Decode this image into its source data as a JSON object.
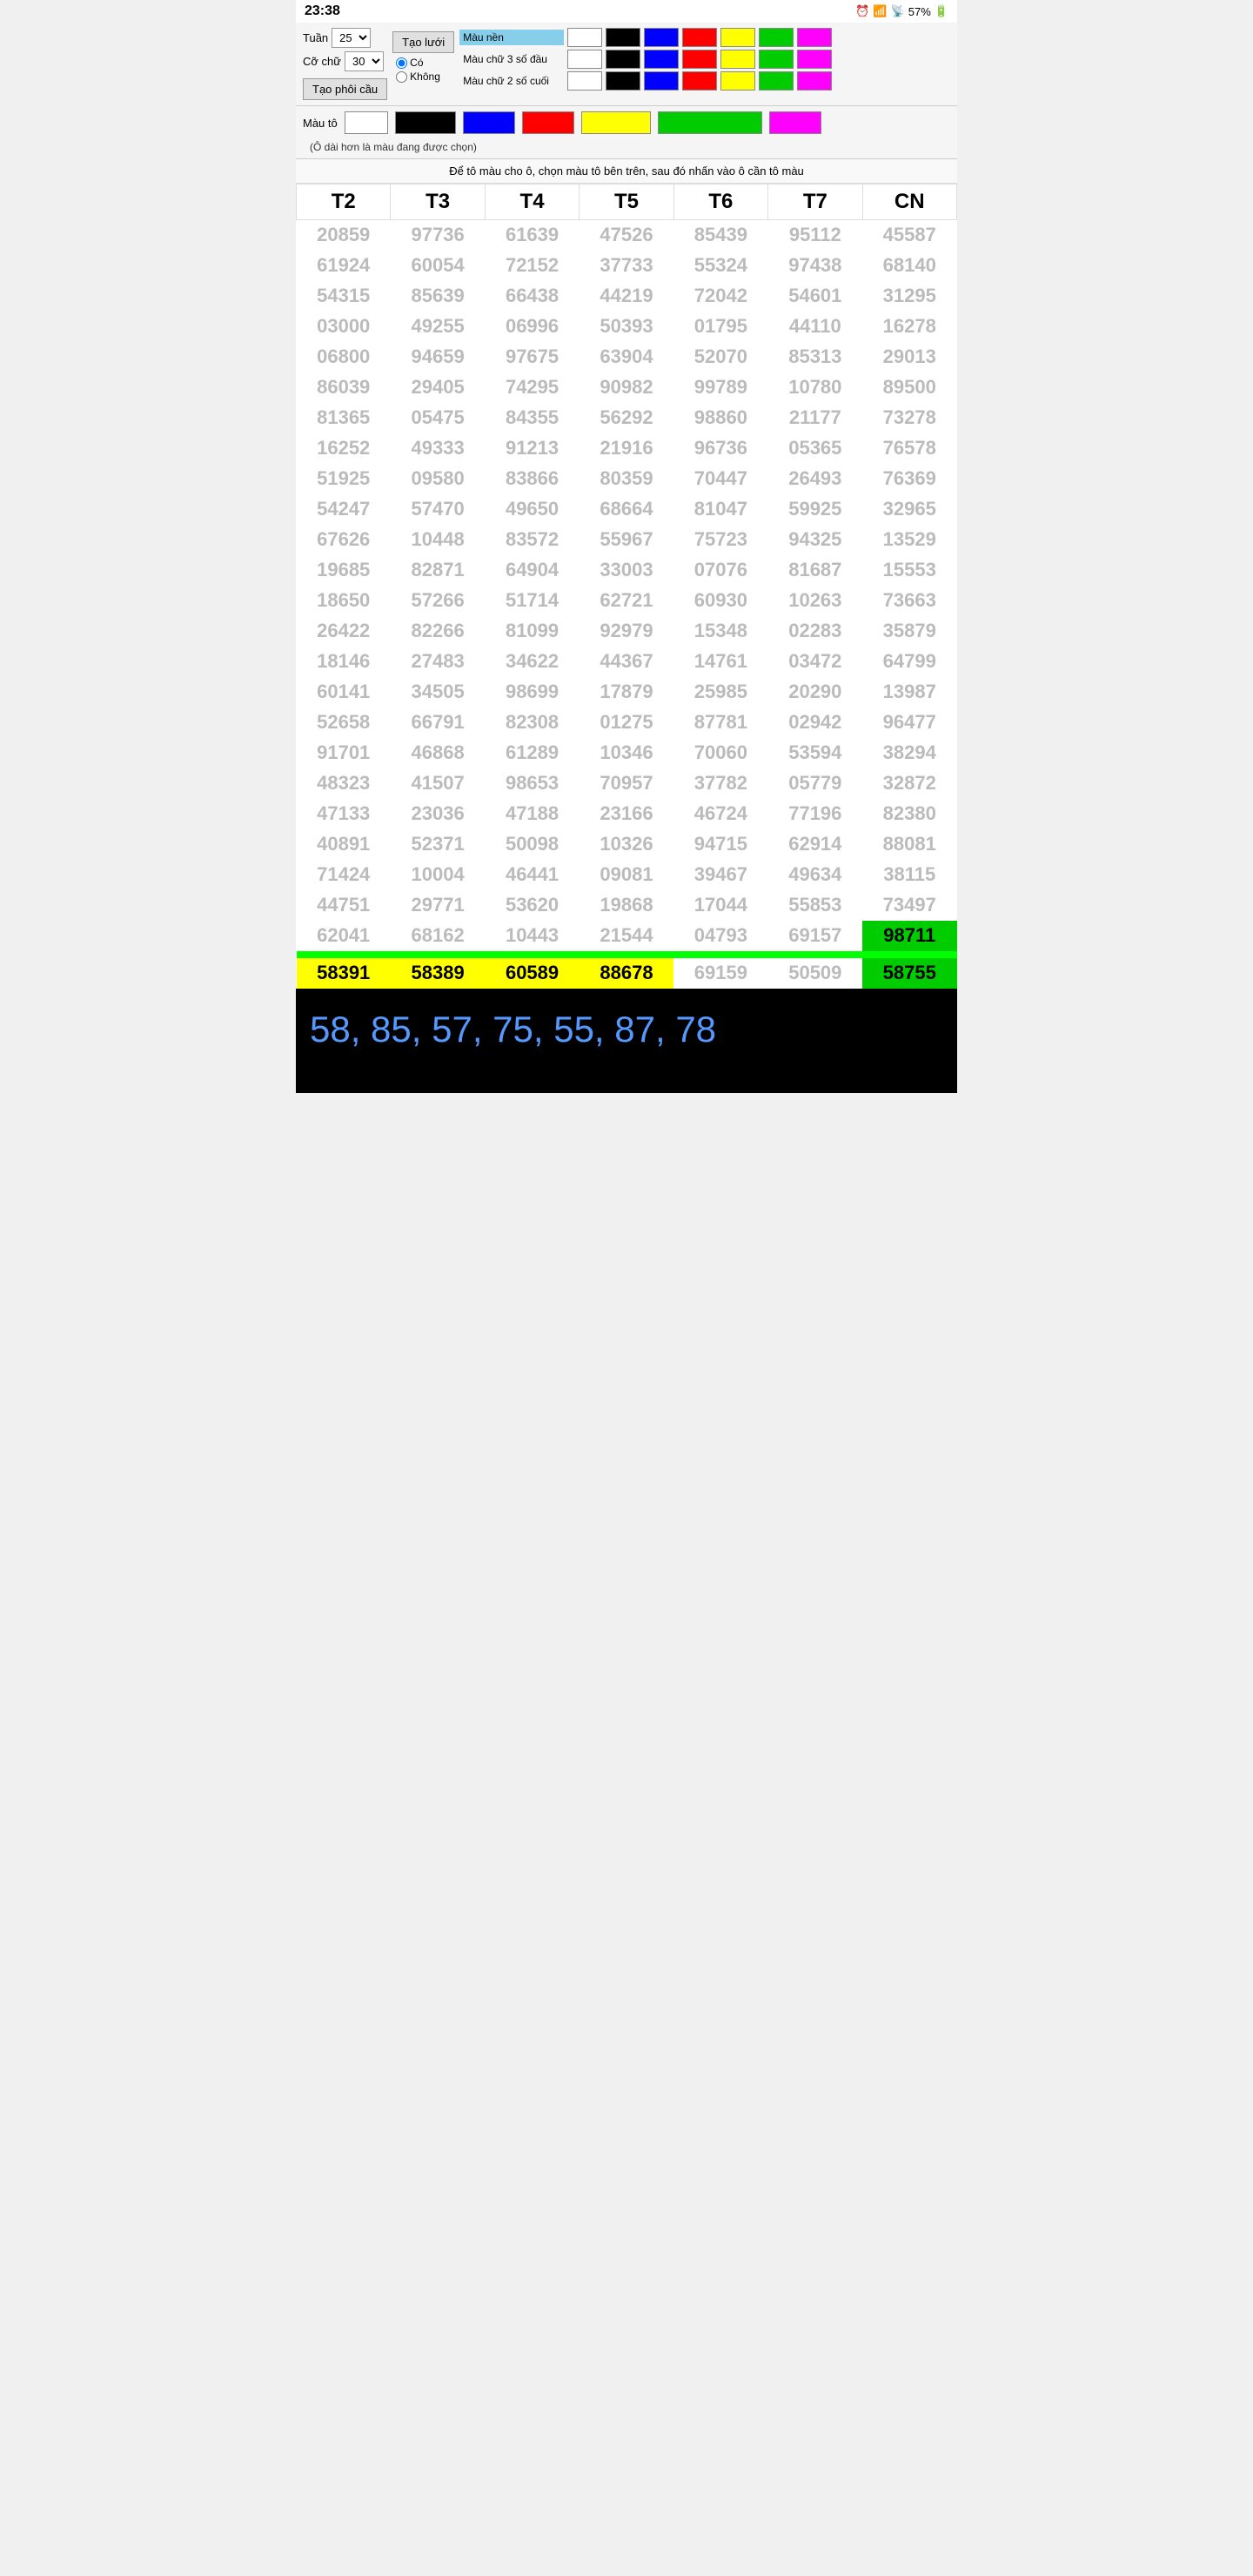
{
  "statusBar": {
    "time": "23:38",
    "battery": "57%",
    "signal": "4G"
  },
  "controls": {
    "tuan_label": "Tuần",
    "tuan_value": "25",
    "cochuu_label": "Cỡ chữ",
    "cochuu_value": "30",
    "btn_tao_luoi": "Tạo lưới",
    "btn_tao_phoi_cau": "Tạo phôi cầu",
    "radio_co": "Có",
    "radio_khong": "Không"
  },
  "colorSection": {
    "mau_nen_label": "Màu nền",
    "mau_chu_3_label": "Màu chữ 3 số đầu",
    "mau_chu_2_label": "Màu chữ 2 số cuối",
    "colors": [
      "white",
      "black",
      "blue",
      "red",
      "yellow",
      "green",
      "magenta"
    ]
  },
  "mauTo": {
    "label": "Màu tô",
    "note": "(Ô dài hơn là màu đang được chọn)"
  },
  "instruction": "Để tô màu cho ô, chọn màu tô bên trên, sau đó nhấn vào ô cần tô màu",
  "tableHeaders": [
    "T2",
    "T3",
    "T4",
    "T5",
    "T6",
    "T7",
    "CN"
  ],
  "tableRows": [
    [
      "20859",
      "97736",
      "61639",
      "47526",
      "85439",
      "95112",
      "45587"
    ],
    [
      "61924",
      "60054",
      "72152",
      "37733",
      "55324",
      "97438",
      "68140"
    ],
    [
      "54315",
      "85639",
      "66438",
      "44219",
      "72042",
      "54601",
      "31295"
    ],
    [
      "03000",
      "49255",
      "06996",
      "50393",
      "01795",
      "44110",
      "16278"
    ],
    [
      "06800",
      "94659",
      "97675",
      "63904",
      "52070",
      "85313",
      "29013"
    ],
    [
      "86039",
      "29405",
      "74295",
      "90982",
      "99789",
      "10780",
      "89500"
    ],
    [
      "81365",
      "05475",
      "84355",
      "56292",
      "98860",
      "21177",
      "73278"
    ],
    [
      "16252",
      "49333",
      "91213",
      "21916",
      "96736",
      "05365",
      "76578"
    ],
    [
      "51925",
      "09580",
      "83866",
      "80359",
      "70447",
      "26493",
      "76369"
    ],
    [
      "54247",
      "57470",
      "49650",
      "68664",
      "81047",
      "59925",
      "32965"
    ],
    [
      "67626",
      "10448",
      "83572",
      "55967",
      "75723",
      "94325",
      "13529"
    ],
    [
      "19685",
      "82871",
      "64904",
      "33003",
      "07076",
      "81687",
      "15553"
    ],
    [
      "18650",
      "57266",
      "51714",
      "62721",
      "60930",
      "10263",
      "73663"
    ],
    [
      "26422",
      "82266",
      "81099",
      "92979",
      "15348",
      "02283",
      "35879"
    ],
    [
      "18146",
      "27483",
      "34622",
      "44367",
      "14761",
      "03472",
      "64799"
    ],
    [
      "60141",
      "34505",
      "98699",
      "17879",
      "25985",
      "20290",
      "13987"
    ],
    [
      "52658",
      "66791",
      "82308",
      "01275",
      "87781",
      "02942",
      "96477"
    ],
    [
      "91701",
      "46868",
      "61289",
      "10346",
      "70060",
      "53594",
      "38294"
    ],
    [
      "48323",
      "41507",
      "98653",
      "70957",
      "37782",
      "05779",
      "32872"
    ],
    [
      "47133",
      "23036",
      "47188",
      "23166",
      "46724",
      "77196",
      "82380"
    ],
    [
      "40891",
      "52371",
      "50098",
      "10326",
      "94715",
      "62914",
      "88081"
    ],
    [
      "71424",
      "10004",
      "46441",
      "09081",
      "39467",
      "49634",
      "38115"
    ],
    [
      "44751",
      "29771",
      "53620",
      "19868",
      "17044",
      "55853",
      "73497"
    ],
    [
      "62041",
      "68162",
      "10443",
      "21544",
      "04793",
      "69157",
      "98711"
    ],
    [
      "58391",
      "58389",
      "60589",
      "88678",
      "69159",
      "50509",
      "58755"
    ]
  ],
  "highlightLastRow": {
    "rowIndex": 24,
    "yellowCols": [
      0,
      1,
      2,
      3
    ],
    "greenCols": [
      6
    ]
  },
  "highlightSecondLast": {
    "rowIndex": 23,
    "yellowCols": [],
    "greenCols": [
      6
    ]
  },
  "handwritten": "58, 85, 57, 75, 55, 87, 78"
}
